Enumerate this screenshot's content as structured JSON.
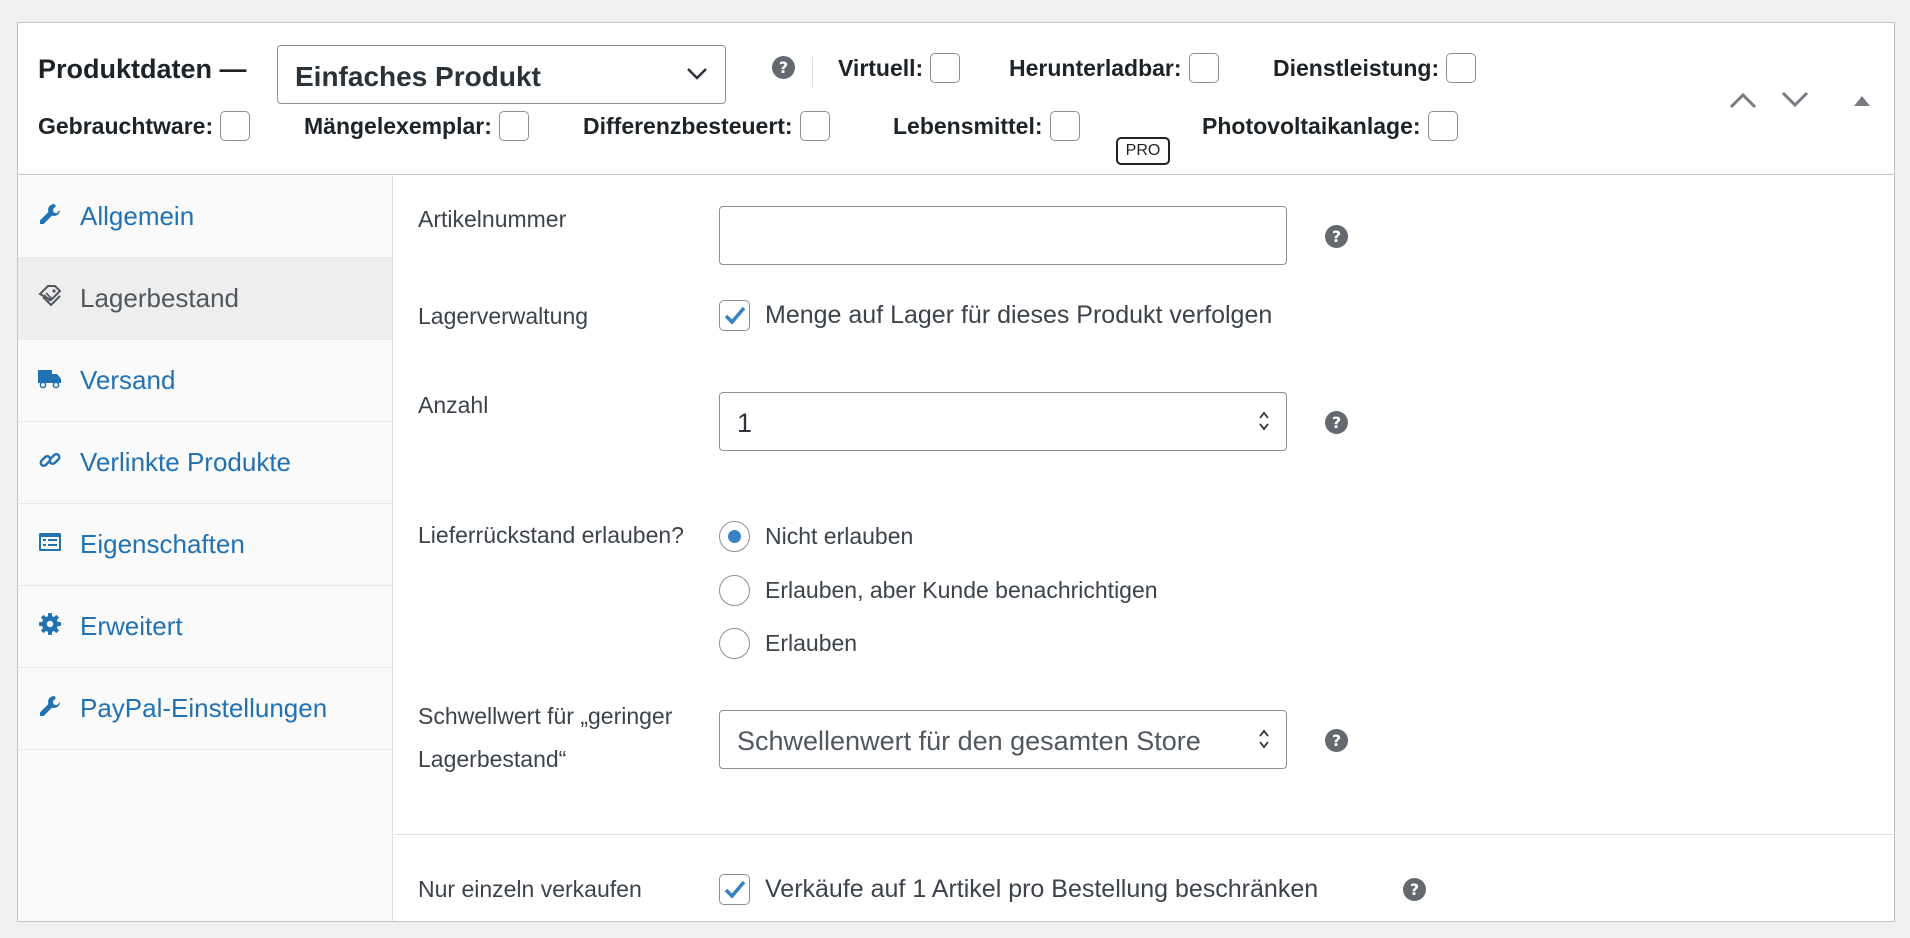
{
  "header": {
    "title": "Produktdaten —",
    "product_type": "Einfaches Produkt",
    "options_row1": [
      {
        "label": "Virtuell:"
      },
      {
        "label": "Herunterladbar:"
      },
      {
        "label": "Dienstleistung:"
      }
    ],
    "options_row2": [
      {
        "label": "Gebrauchtware:"
      },
      {
        "label": "Mängelexemplar:"
      },
      {
        "label": "Differenzbesteuert:"
      },
      {
        "label": "Lebensmittel:"
      },
      {
        "label": "Photovoltaikanlage:"
      }
    ],
    "pro_badge": "PRO",
    "help_glyph": "?"
  },
  "sidebar": {
    "items": [
      {
        "label": "Allgemein",
        "icon": "wrench-icon",
        "active": false
      },
      {
        "label": "Lagerbestand",
        "icon": "tag-icon",
        "active": true
      },
      {
        "label": "Versand",
        "icon": "truck-icon",
        "active": false
      },
      {
        "label": "Verlinkte Produkte",
        "icon": "link-icon",
        "active": false
      },
      {
        "label": "Eigenschaften",
        "icon": "list-icon",
        "active": false
      },
      {
        "label": "Erweitert",
        "icon": "gear-icon",
        "active": false
      },
      {
        "label": "PayPal-Einstellungen",
        "icon": "wrench-icon",
        "active": false
      }
    ]
  },
  "inventory": {
    "sku": {
      "label": "Artikelnummer",
      "value": ""
    },
    "manage_stock": {
      "label": "Lagerverwaltung",
      "checkbox_label": "Menge auf Lager für dieses Produkt verfolgen",
      "checked": true
    },
    "quantity": {
      "label": "Anzahl",
      "value": "1"
    },
    "backorders": {
      "label": "Lieferrückstand erlauben?",
      "options": [
        {
          "label": "Nicht erlauben",
          "selected": true
        },
        {
          "label": "Erlauben, aber Kunde benachrichtigen",
          "selected": false
        },
        {
          "label": "Erlauben",
          "selected": false
        }
      ]
    },
    "low_stock": {
      "label_line1": "Schwellwert für „geringer",
      "label_line2": "Lagerbestand“",
      "placeholder": "Schwellenwert für den gesamten Store"
    },
    "sold_individually": {
      "label": "Nur einzeln verkaufen",
      "checkbox_label": "Verkäufe auf 1 Artikel pro Bestellung beschränken",
      "checked": true
    }
  },
  "colors": {
    "accent": "#2271b1",
    "check": "#3582c4",
    "help_bg": "#646970",
    "border": "#c3c4c7"
  }
}
